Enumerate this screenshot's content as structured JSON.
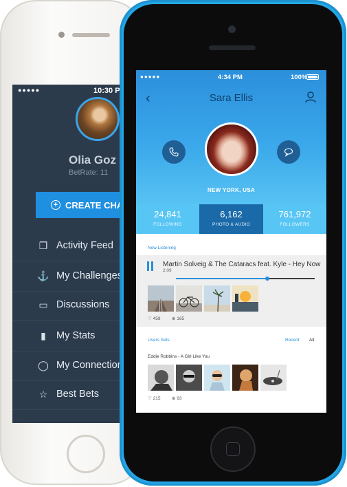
{
  "back_phone": {
    "status_time": "10:30 P",
    "signal": "●●●●●",
    "user_name": "Olia Goz",
    "bet_rate": "BetRate:  11",
    "create_button": "CREATE CHA",
    "menu": [
      {
        "label": "Activity Feed",
        "icon": "activity-feed-icon",
        "glyph": "❐"
      },
      {
        "label": "My Challenges",
        "icon": "anchor-icon",
        "glyph": "⚓"
      },
      {
        "label": "Discussions",
        "icon": "speech-bubble-icon",
        "glyph": "▭"
      },
      {
        "label": "My Stats",
        "icon": "bar-chart-icon",
        "glyph": "▮"
      },
      {
        "label": "My Connection",
        "icon": "person-icon",
        "glyph": "◯"
      },
      {
        "label": "Best Bets",
        "icon": "star-icon",
        "glyph": "☆"
      }
    ]
  },
  "front_phone": {
    "status": {
      "signal": "●●●●●",
      "time": "4:34 PM",
      "battery": "100%"
    },
    "profile": {
      "name": "Sara Ellis",
      "location": "NEW YORK, USA"
    },
    "stats": [
      {
        "value": "24,841",
        "label": "FOLLOWING"
      },
      {
        "value": "6,162",
        "label": "PHOTO & AUDIO"
      },
      {
        "value": "761,972",
        "label": "FOLLOWERS"
      }
    ],
    "now_listening": {
      "label": "Now Listening",
      "track": "Martin Solveig & The Cataracs feat. Kyle - Hey Now",
      "time": "2:09",
      "progress": 0.66,
      "likes": "458",
      "shares": "165"
    },
    "users_sets": {
      "label": "Users Sets",
      "tab_recent": "Recent",
      "tab_all": "All",
      "set_title": "Eddie Robbins - A Girl Like You",
      "likes": "215",
      "shares": "93"
    }
  },
  "colors": {
    "phone_blue": "#24a6e6",
    "header_blue": "#3aa8ea",
    "accent": "#2a8fd9",
    "selected_stat": "#1a6aa9",
    "sidebar_bg": "#2c3b4c",
    "create_button": "#1f8fe0"
  }
}
